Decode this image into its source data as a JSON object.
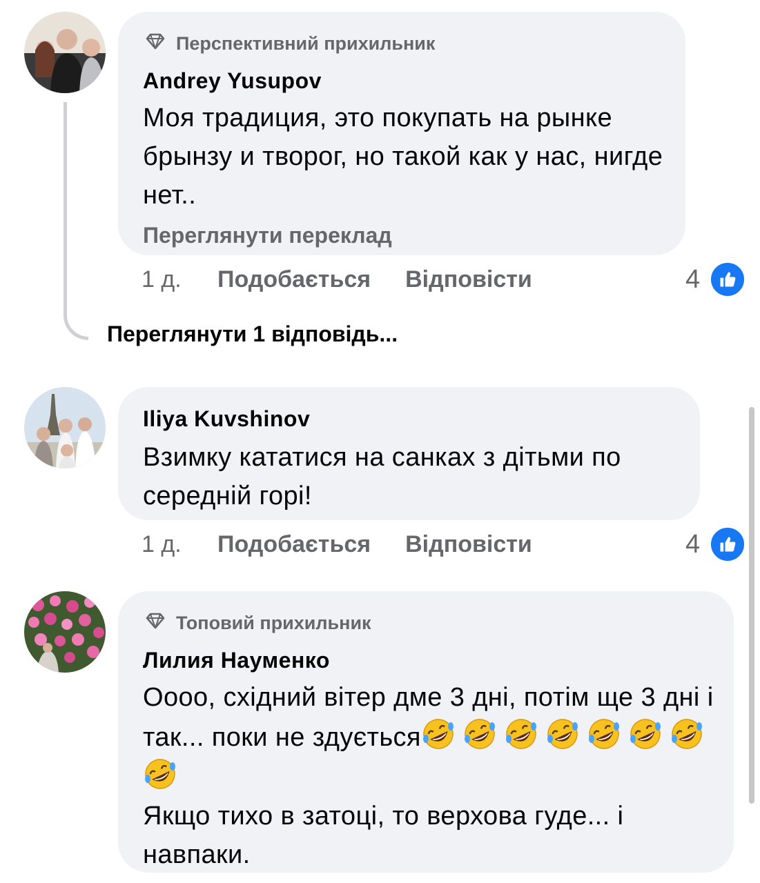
{
  "comments": [
    {
      "badge": "Перспективний прихильник",
      "author": "Andrey  Yusupov",
      "text": "Моя традиция, это покупать на рынке брынзу и творог, но такой как у нас, нигде нет..",
      "translate_link": "Переглянути переклад",
      "time": "1 д.",
      "like_label": "Подобається",
      "reply_label": "Відповісти",
      "likes": "4"
    },
    {
      "author": "Iliya Kuvshinov",
      "text": "Взимку кататися на санках з дітьми по середній горі!",
      "time": "1 д.",
      "like_label": "Подобається",
      "reply_label": "Відповісти",
      "likes": "4"
    },
    {
      "badge": "Топовий прихильник",
      "author": "Лилия Науменко",
      "text_line1": "Оооо, східний вітер дме 3 дні, потім ще 3 дні і так... поки не здується",
      "text_line2": "Якщо тихо в затоці, то верхова гуде... і навпаки."
    }
  ],
  "view_replies": "Переглянути 1 відповідь...",
  "icons": {
    "badge": "diamond-badge-icon",
    "like": "thumbs-up-icon",
    "emoji": "rolling-on-floor-laughing-emoji"
  },
  "colors": {
    "bubble": "#f0f2f5",
    "secondary_text": "#65676b",
    "like_blue": "#1877f2"
  }
}
